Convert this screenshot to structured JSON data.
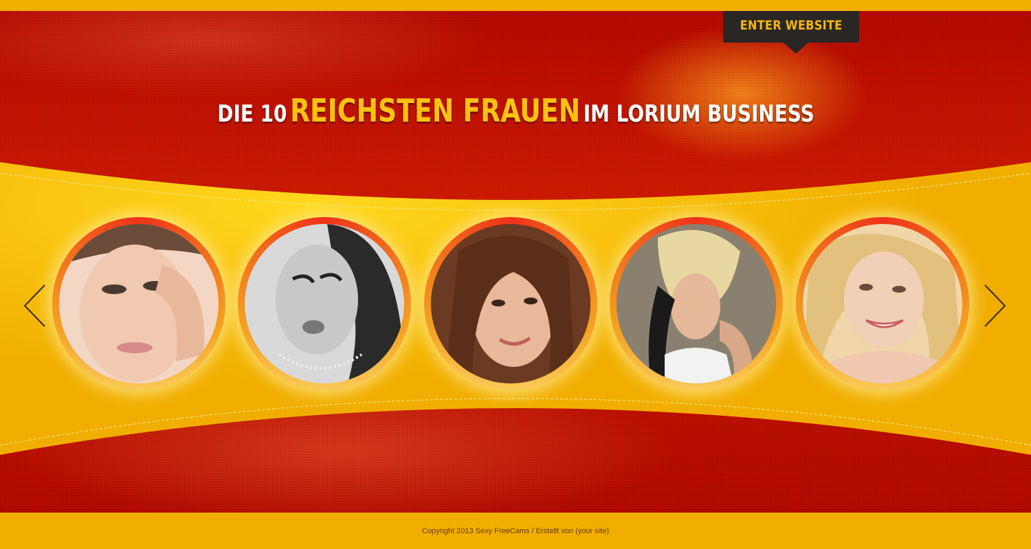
{
  "header": {
    "enter_button": "ENTER WEBSITE",
    "headline_part1": "DIE 10",
    "headline_highlight": "REICHSTEN FRAUEN",
    "headline_part2": "IM LORIUM BUSINESS"
  },
  "carousel": {
    "prev_icon": "chevron-left-icon",
    "next_icon": "chevron-right-icon",
    "portraits": [
      {
        "name": "portrait-1"
      },
      {
        "name": "portrait-2"
      },
      {
        "name": "portrait-3"
      },
      {
        "name": "portrait-4"
      },
      {
        "name": "portrait-5"
      }
    ]
  },
  "footer": {
    "copyright": "Copyright 2013 Sexy FreeCams / Erstellt von (your site)"
  },
  "colors": {
    "background_red": "#c81200",
    "band_yellow": "#f1ae00",
    "headline_highlight": "#fcc211",
    "tab_dark": "#2a2624"
  }
}
